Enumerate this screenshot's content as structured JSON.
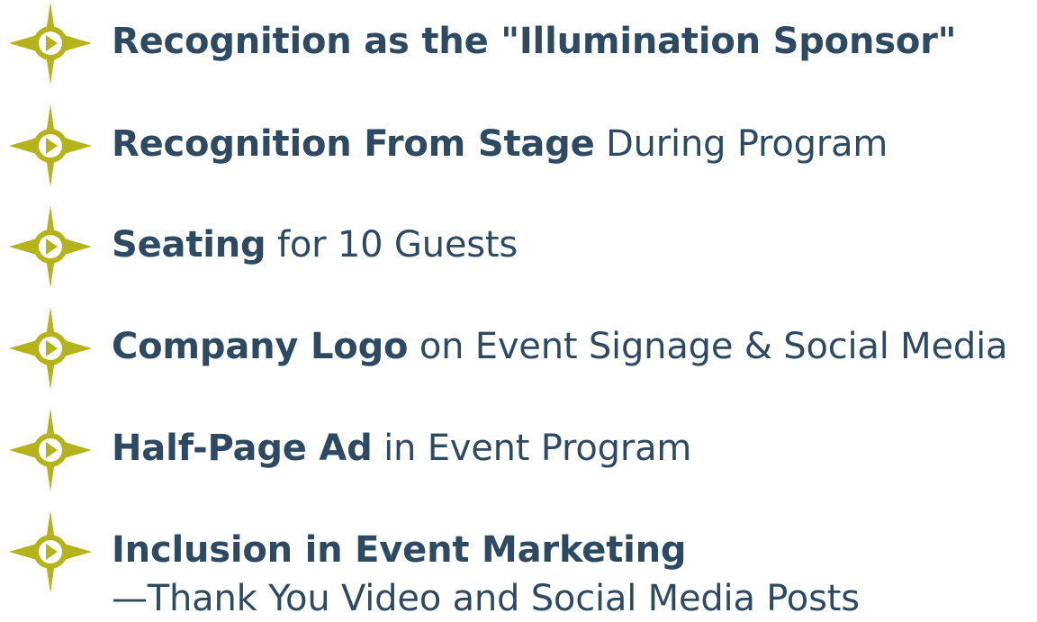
{
  "accent_color": "#b5b31c",
  "text_color": "#2e4a62",
  "bullet_icon": "compass-star-icon",
  "benefits": [
    {
      "bold": "Recognition as the \"Illumination Sponsor\"",
      "rest": ""
    },
    {
      "bold": "Recognition From Stage",
      "rest": " During Program"
    },
    {
      "bold": "Seating",
      "rest": " for 10 Guests"
    },
    {
      "bold": "Company Logo",
      "rest": " on Event Signage & Social Media"
    },
    {
      "bold": "Half-Page Ad",
      "rest": " in Event Program"
    },
    {
      "bold": "Inclusion in Event Marketing",
      "rest": "",
      "subline": "—Thank You Video and Social Media Posts"
    }
  ]
}
